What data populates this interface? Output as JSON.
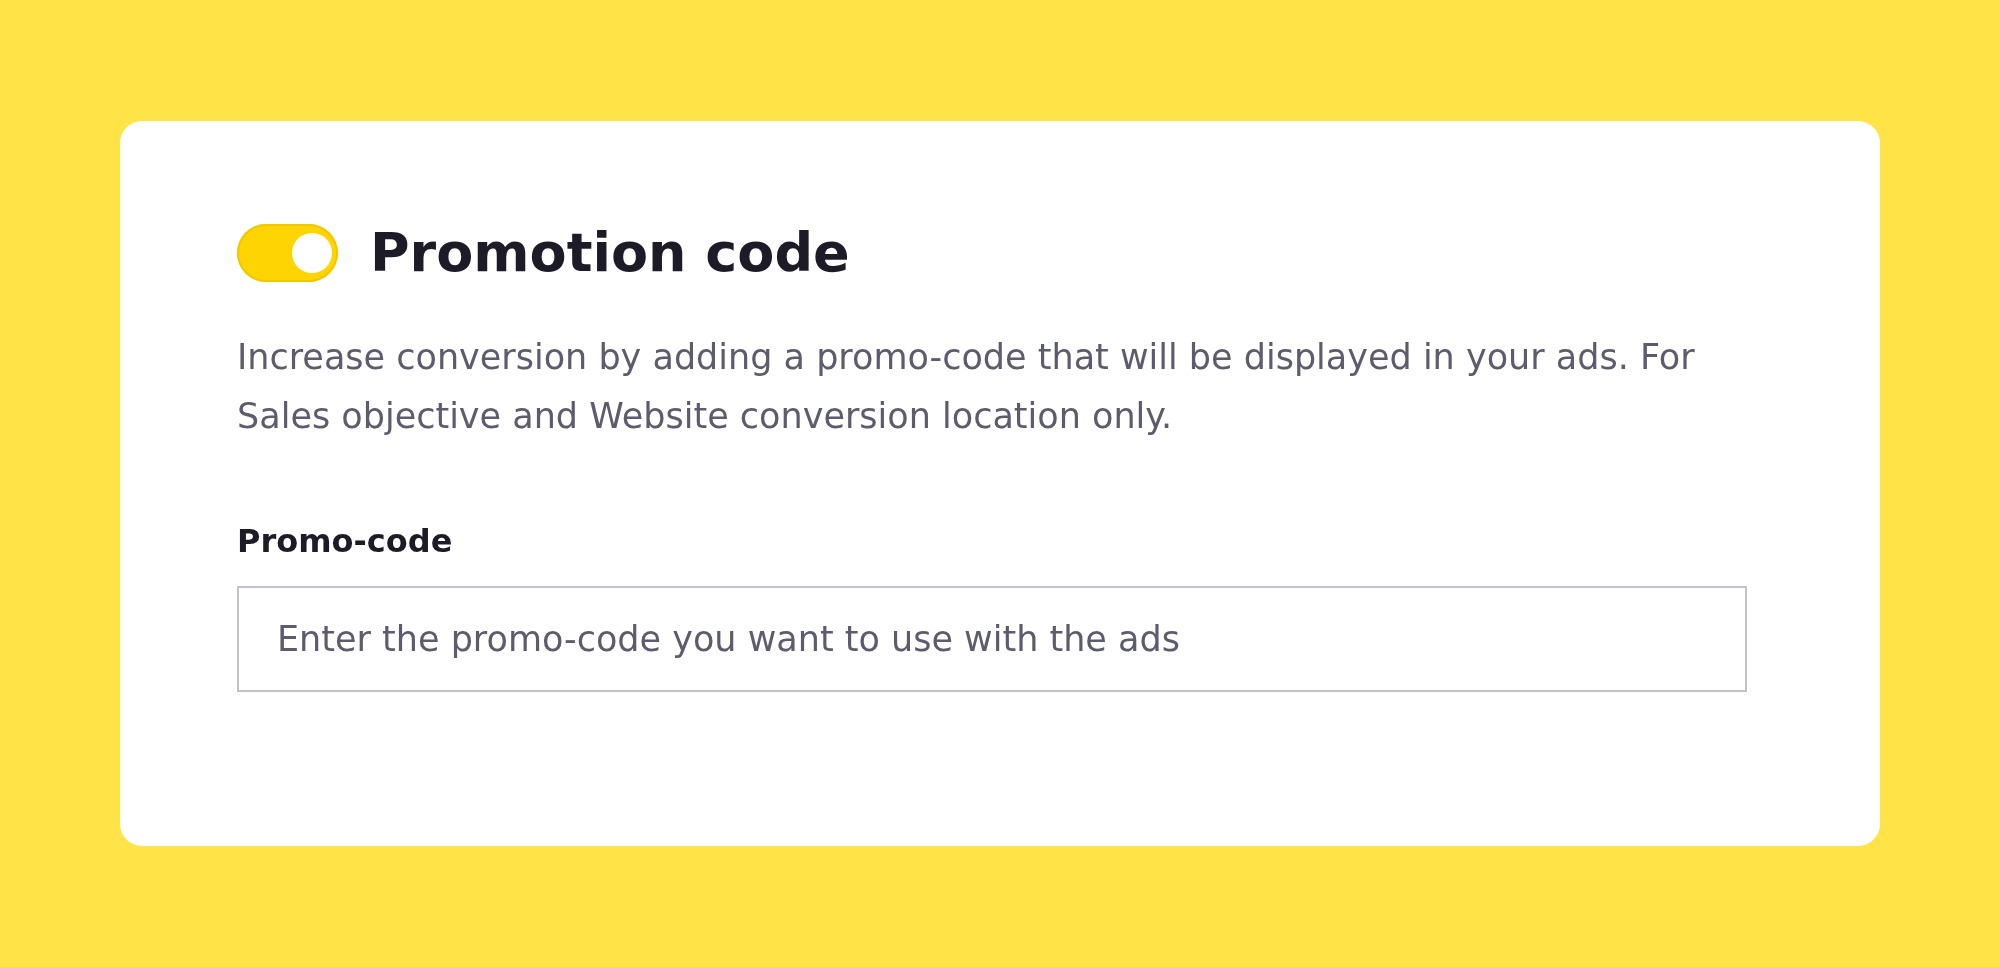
{
  "setting": {
    "title": "Promotion code",
    "on": true,
    "description": "Increase conversion by adding a promo-code that will be displayed in your ads. For Sales objective and Website conversion location only."
  },
  "field": {
    "label": "Promo-code",
    "placeholder": "Enter the promo-code you want to use with the ads"
  }
}
